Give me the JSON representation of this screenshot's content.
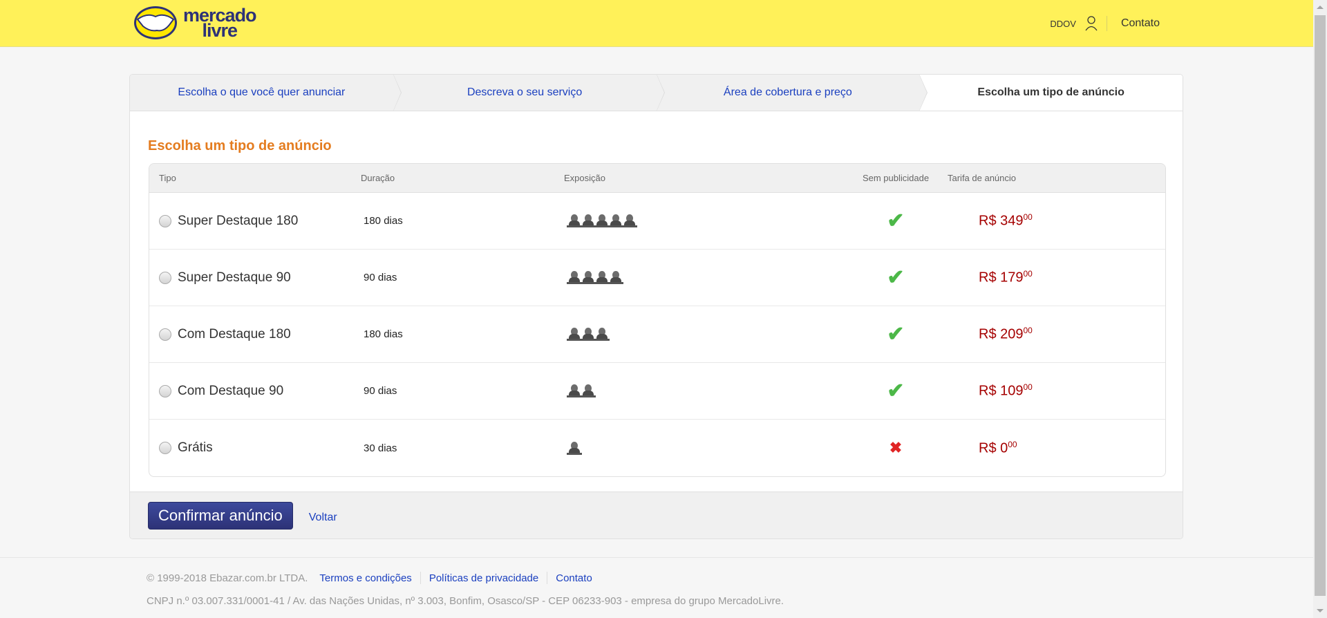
{
  "header": {
    "logo_line1": "mercado",
    "logo_line2": "livre",
    "user": "DDOV",
    "contact": "Contato"
  },
  "steps": [
    {
      "label": "Escolha o que você quer anunciar",
      "active": false
    },
    {
      "label": "Descreva o seu serviço",
      "active": false
    },
    {
      "label": "Área de cobertura e preço",
      "active": false
    },
    {
      "label": "Escolha um tipo de anúncio",
      "active": true
    }
  ],
  "main": {
    "heading": "Escolha um tipo de anúncio",
    "columns": [
      "Tipo",
      "Duração",
      "Exposição",
      "Sem publicidade",
      "Tarifa de anúncio"
    ],
    "rows": [
      {
        "type": "Super Destaque 180",
        "duration": "180 dias",
        "exposure": 5,
        "no_ads": true,
        "price": "R$ 349",
        "cents": "00"
      },
      {
        "type": "Super Destaque 90",
        "duration": "90 dias",
        "exposure": 4,
        "no_ads": true,
        "price": "R$ 179",
        "cents": "00"
      },
      {
        "type": "Com Destaque 180",
        "duration": "180 dias",
        "exposure": 3,
        "no_ads": true,
        "price": "R$ 209",
        "cents": "00"
      },
      {
        "type": "Com Destaque 90",
        "duration": "90 dias",
        "exposure": 2,
        "no_ads": true,
        "price": "R$ 109",
        "cents": "00"
      },
      {
        "type": "Grátis",
        "duration": "30 dias",
        "exposure": 1,
        "no_ads": false,
        "price": "R$ 0",
        "cents": "00"
      }
    ],
    "confirm_label": "Confirmar anúncio",
    "back_label": "Voltar"
  },
  "footer": {
    "copyright": "© 1999-2018 Ebazar.com.br LTDA.",
    "links": [
      "Termos e condições",
      "Políticas de privacidade",
      "Contato"
    ],
    "address": "CNPJ n.º 03.007.331/0001-41 / Av. das Nações Unidas, nº 3.003, Bonfim, Osasco/SP - CEP 06233-903 - empresa do grupo MercadoLivre."
  },
  "colors": {
    "brand_yellow": "#fff159",
    "accent_orange": "#e47c1f",
    "price_red": "#a50000",
    "link_blue": "#1a3fbf",
    "button_navy": "#2d3277"
  }
}
